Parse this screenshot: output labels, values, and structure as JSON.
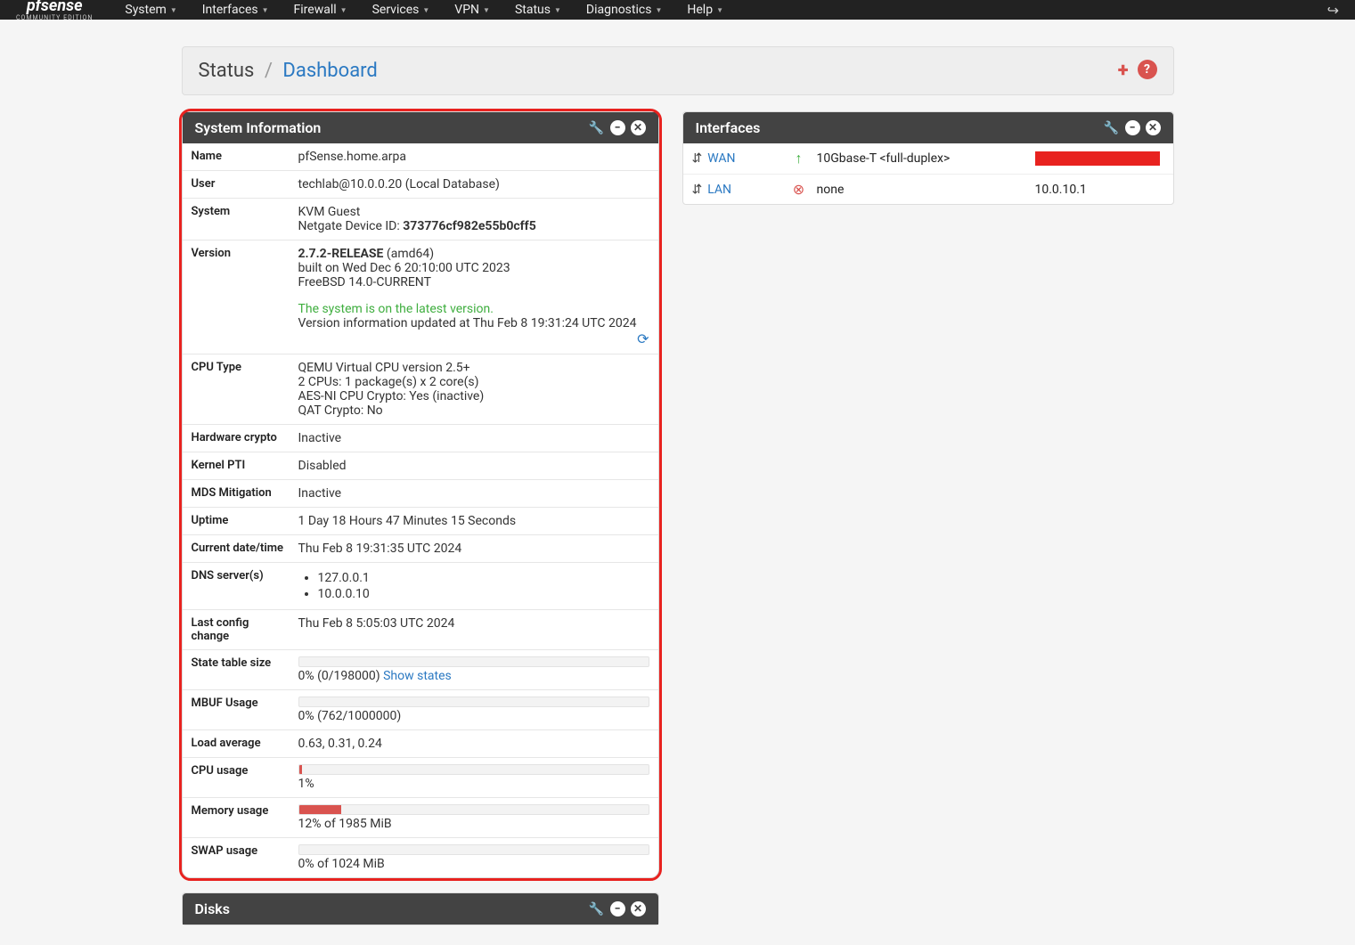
{
  "nav": {
    "brand": "pfsense",
    "edition": "COMMUNITY EDITION",
    "menu": [
      "System",
      "Interfaces",
      "Firewall",
      "Services",
      "VPN",
      "Status",
      "Diagnostics",
      "Help"
    ]
  },
  "breadcrumb": {
    "root": "Status",
    "active": "Dashboard"
  },
  "sysinfo": {
    "title": "System Information",
    "name_label": "Name",
    "name": "pfSense.home.arpa",
    "user_label": "User",
    "user": "techlab@10.0.0.20 (Local Database)",
    "system_label": "System",
    "system1": "KVM Guest",
    "system2_prefix": "Netgate Device ID: ",
    "system2_id": "373776cf982e55b0cff5",
    "version_label": "Version",
    "version_rel": "2.7.2-RELEASE",
    "version_arch": " (amd64)",
    "version_built": "built on Wed Dec 6 20:10:00 UTC 2023",
    "version_os": "FreeBSD 14.0-CURRENT",
    "version_status": "The system is on the latest version.",
    "version_updated": "Version information updated at Thu Feb 8 19:31:24 UTC 2024",
    "cpu_label": "CPU Type",
    "cpu_l1": "QEMU Virtual CPU version 2.5+",
    "cpu_l2": "2 CPUs: 1 package(s) x 2 core(s)",
    "cpu_l3": "AES-NI CPU Crypto: Yes (inactive)",
    "cpu_l4": "QAT Crypto: No",
    "hwcrypto_label": "Hardware crypto",
    "hwcrypto": "Inactive",
    "kpti_label": "Kernel PTI",
    "kpti": "Disabled",
    "mds_label": "MDS Mitigation",
    "mds": "Inactive",
    "uptime_label": "Uptime",
    "uptime": "1 Day 18 Hours 47 Minutes 15 Seconds",
    "datetime_label": "Current date/time",
    "datetime": "Thu Feb 8 19:31:35 UTC 2024",
    "dns_label": "DNS server(s)",
    "dns": [
      "127.0.0.1",
      "10.0.0.10"
    ],
    "lastcfg_label": "Last config change",
    "lastcfg": "Thu Feb 8 5:05:03 UTC 2024",
    "state_label": "State table size",
    "state_pct": 0,
    "state_text": "0% (0/198000) ",
    "state_link": "Show states",
    "mbuf_label": "MBUF Usage",
    "mbuf_pct": 0,
    "mbuf_text": "0% (762/1000000)",
    "load_label": "Load average",
    "load": "0.63, 0.31, 0.24",
    "cpuu_label": "CPU usage",
    "cpuu_pct": 1,
    "cpuu_text": "1%",
    "mem_label": "Memory usage",
    "mem_pct": 12,
    "mem_text": "12% of 1985 MiB",
    "swap_label": "SWAP usage",
    "swap_pct": 0,
    "swap_text": "0% of 1024 MiB"
  },
  "disks_title": "Disks",
  "interfaces": {
    "title": "Interfaces",
    "rows": [
      {
        "name": "WAN",
        "status": "up",
        "media": "10Gbase-T <full-duplex>",
        "addr": ""
      },
      {
        "name": "LAN",
        "status": "down",
        "media": "none",
        "addr": "10.0.10.1"
      }
    ]
  }
}
